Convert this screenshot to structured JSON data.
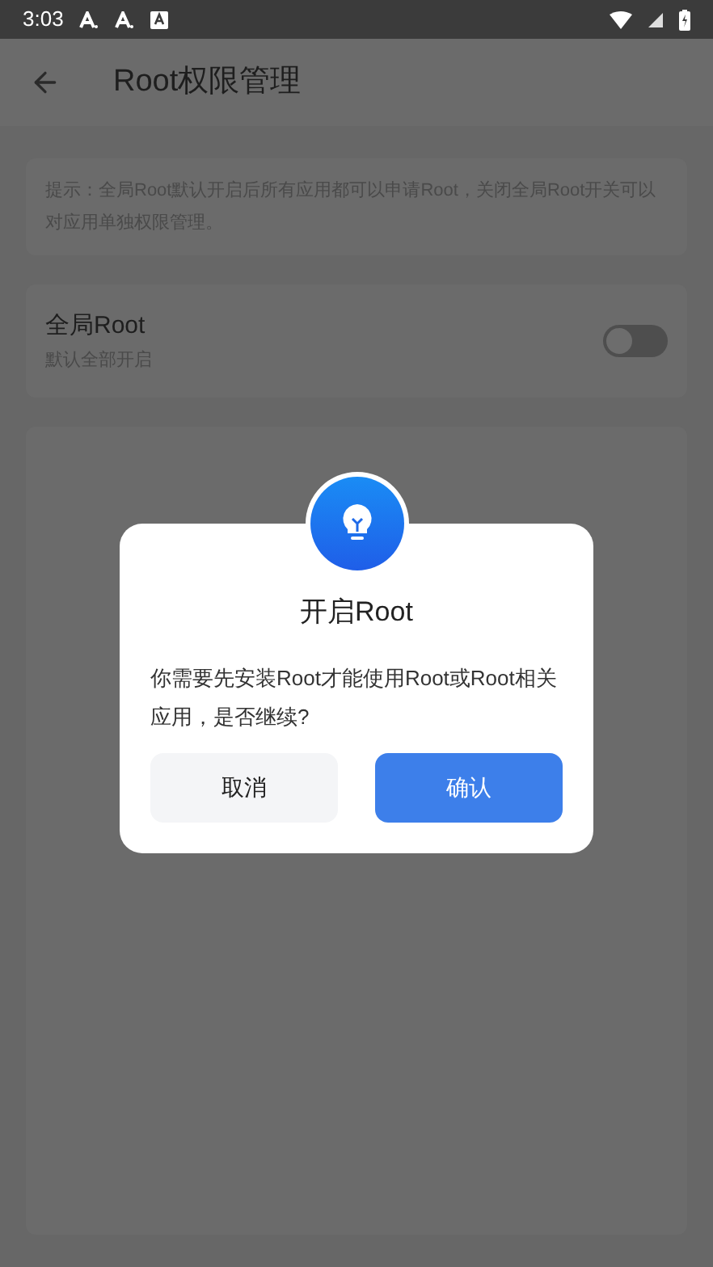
{
  "status_bar": {
    "time": "3:03"
  },
  "header": {
    "title": "Root权限管理"
  },
  "tip": {
    "text": "提示：全局Root默认开启后所有应用都可以申请Root，关闭全局Root开关可以对应用单独权限管理。"
  },
  "setting": {
    "title": "全局Root",
    "subtitle": "默认全部开启",
    "on": false
  },
  "dialog": {
    "title": "开启Root",
    "message": "你需要先安装Root才能使用Root或Root相关应用，是否继续?",
    "buttons": [
      {
        "label": "取消",
        "kind": "secondary"
      },
      {
        "label": "确认",
        "kind": "primary"
      }
    ]
  }
}
